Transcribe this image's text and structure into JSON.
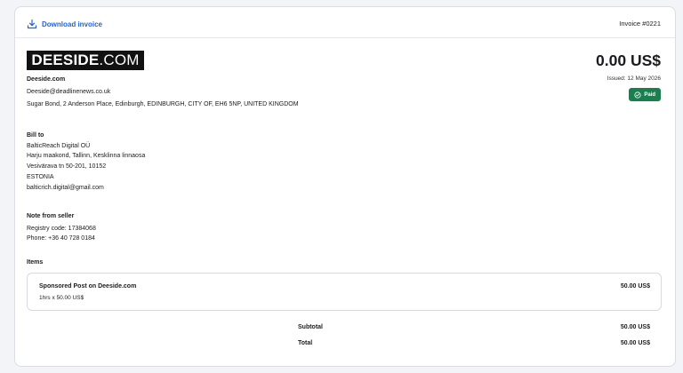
{
  "header": {
    "download_label": "Download invoice",
    "invoice_number": "Invoice #0221"
  },
  "logo": {
    "bold": "DEESIDE",
    "rest": ".COM"
  },
  "seller": {
    "name": "Deeside.com",
    "email": "Deeside@deadlinenews.co.uk",
    "address": "Sugar Bond, 2 Anderson Place, Edinburgh, EDINBURGH, CITY OF, EH6 5NP, UNITED KINGDOM"
  },
  "summary": {
    "amount": "0.00 US$",
    "issued": "Issued: 12 May 2026",
    "status": "Paid",
    "status_color": "#1a7f4e"
  },
  "bill_to": {
    "heading": "Bill to",
    "lines": [
      "BalticReach Digital OÜ",
      "Harju maakond, Tallinn, Kesklinna linnaosa",
      "Vesivärava tn 50-201, 10152",
      "ESTONIA",
      "balticrich.digital@gmail.com"
    ]
  },
  "note": {
    "heading": "Note from seller",
    "lines": [
      "Registry code: 17384068",
      "Phone: +36 40 728 0184"
    ]
  },
  "items": {
    "heading": "Items",
    "list": [
      {
        "title": "Sponsored Post on Deeside.com",
        "detail": "1hrs x 50.00 US$",
        "amount": "50.00 US$"
      }
    ]
  },
  "totals": {
    "subtotal_label": "Subtotal",
    "subtotal_value": "50.00 US$",
    "total_label": "Total",
    "total_value": "50.00 US$"
  }
}
